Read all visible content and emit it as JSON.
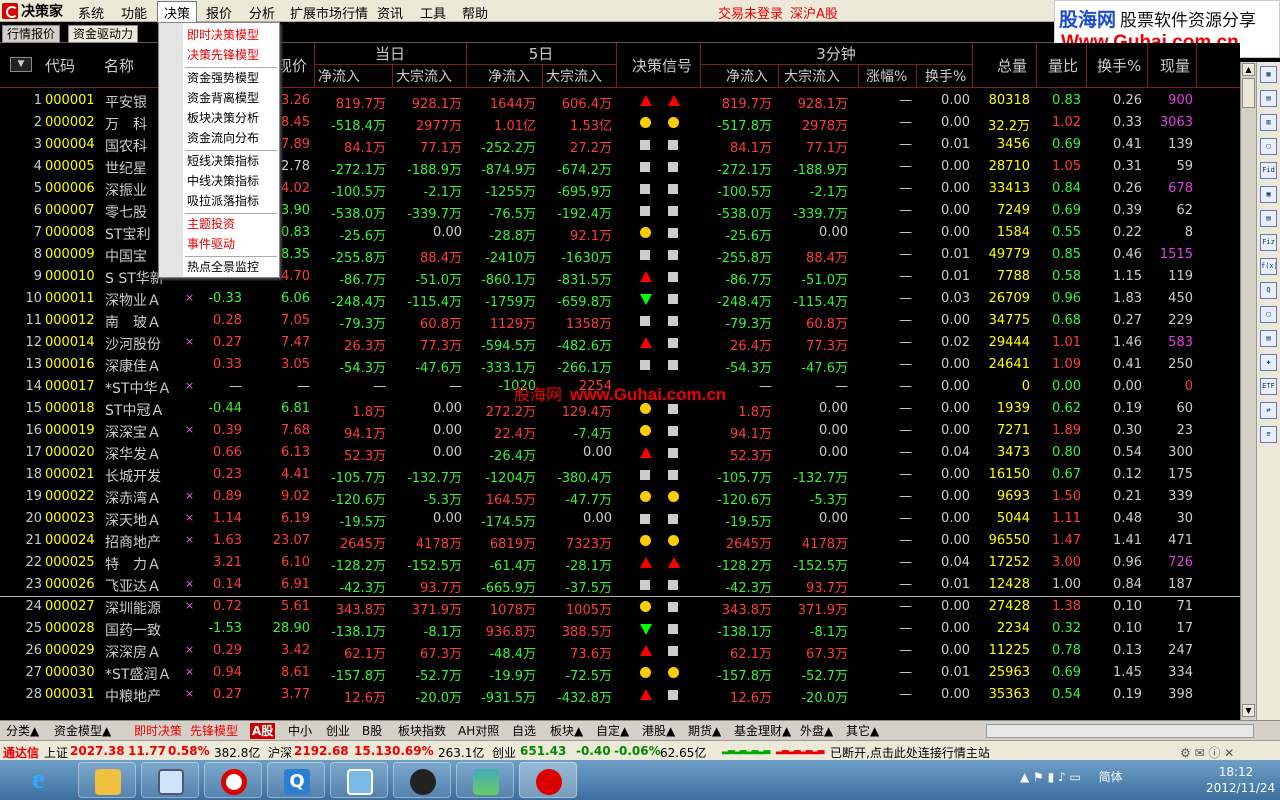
{
  "app": {
    "title": "决策家"
  },
  "menu": [
    "系统",
    "功能",
    "决策",
    "报价",
    "分析",
    "扩展市场行情",
    "资讯",
    "工具",
    "帮助"
  ],
  "menu_active": "决策",
  "trade_status": "交易未登录",
  "market_name": "深沪A股",
  "ad": {
    "site": "股海网",
    "tagline": "股票软件资源分享",
    "url": "Www.Guhai.com.cn"
  },
  "top_tabs": [
    "行情报价",
    "资金驱动力"
  ],
  "dropdown": [
    "即时决策模型",
    "决策先锋模型",
    "资金强势模型",
    "资金背离模型",
    "板块决策分析",
    "资金流向分布",
    "短线决策指标",
    "中线决策指标",
    "吸拉派落指标",
    "主题投资",
    "事件驱动",
    "热点全景监控"
  ],
  "dropdown_hot": [
    true,
    true,
    false,
    false,
    false,
    false,
    false,
    false,
    false,
    true,
    true,
    false
  ],
  "header": {
    "code": "代码",
    "name": "名称",
    "price": "现价",
    "today": "当日",
    "five_day": "5日",
    "signal": "决策信号",
    "three_min": "3分钟",
    "net_in": "净流入",
    "block_in": "大宗流入",
    "change_pct": "涨幅%",
    "turnover_pct": "换手%",
    "total_vol": "总量",
    "vol_ratio": "量比",
    "turnover": "换手%",
    "cur_vol": "现量"
  },
  "rows": [
    {
      "i": "1",
      "code": "000001",
      "name": "平安银",
      "x": "",
      "chg": "",
      "price": "3.26",
      "pc": "red",
      "tn": "819.7万",
      "tnc": "red",
      "tb": "928.1万",
      "tbc": "red",
      "fn": "1644万",
      "fnc": "red",
      "fb": "606.4万",
      "fbc": "red",
      "s1": "up",
      "s2": "up",
      "mn": "819.7万",
      "mnc": "red",
      "mb": "928.1万",
      "mbc": "red",
      "mp": "—",
      "mt": "0.00",
      "vol": "80318",
      "vr": "0.83",
      "vrc": "grn",
      "to": "0.26",
      "cv": "900",
      "cvc": "mag"
    },
    {
      "i": "2",
      "code": "000002",
      "name": "万　科",
      "x": "",
      "chg": "",
      "price": "8.45",
      "pc": "red",
      "tn": "-518.4万",
      "tnc": "grn",
      "tb": "2977万",
      "tbc": "red",
      "fn": "1.01亿",
      "fnc": "red",
      "fb": "1.53亿",
      "fbc": "red",
      "s1": "dot",
      "s2": "dot",
      "mn": "-517.8万",
      "mnc": "grn",
      "mb": "2978万",
      "mbc": "red",
      "mp": "—",
      "mt": "0.00",
      "vol": "32.2万",
      "vr": "1.02",
      "vrc": "red",
      "to": "0.33",
      "cv": "3063",
      "cvc": "mag"
    },
    {
      "i": "3",
      "code": "000004",
      "name": "国农科",
      "x": "",
      "chg": "",
      "price": "7.89",
      "pc": "red",
      "tn": "84.1万",
      "tnc": "red",
      "tb": "77.1万",
      "tbc": "red",
      "fn": "-252.2万",
      "fnc": "grn",
      "fb": "27.2万",
      "fbc": "red",
      "s1": "sq",
      "s2": "sq",
      "mn": "84.1万",
      "mnc": "red",
      "mb": "77.1万",
      "mbc": "red",
      "mp": "—",
      "mt": "0.01",
      "vol": "3456",
      "vr": "0.69",
      "vrc": "grn",
      "to": "0.41",
      "cv": "139",
      "cvc": "wht"
    },
    {
      "i": "4",
      "code": "000005",
      "name": "世纪星",
      "x": "",
      "chg": "",
      "price": "2.78",
      "pc": "wht",
      "tn": "-272.1万",
      "tnc": "grn",
      "tb": "-188.9万",
      "tbc": "grn",
      "fn": "-874.9万",
      "fnc": "grn",
      "fb": "-674.2万",
      "fbc": "grn",
      "s1": "sq",
      "s2": "sq",
      "mn": "-272.1万",
      "mnc": "grn",
      "mb": "-188.9万",
      "mbc": "grn",
      "mp": "—",
      "mt": "0.00",
      "vol": "28710",
      "vr": "1.05",
      "vrc": "red",
      "to": "0.31",
      "cv": "59",
      "cvc": "wht"
    },
    {
      "i": "5",
      "code": "000006",
      "name": "深振业",
      "x": "",
      "chg": "",
      "price": "4.02",
      "pc": "red",
      "tn": "-100.5万",
      "tnc": "grn",
      "tb": "-2.1万",
      "tbc": "grn",
      "fn": "-1255万",
      "fnc": "grn",
      "fb": "-695.9万",
      "fbc": "grn",
      "s1": "sq",
      "s2": "sq",
      "mn": "-100.5万",
      "mnc": "grn",
      "mb": "-2.1万",
      "mbc": "grn",
      "mp": "—",
      "mt": "0.00",
      "vol": "33413",
      "vr": "0.84",
      "vrc": "grn",
      "to": "0.26",
      "cv": "678",
      "cvc": "mag"
    },
    {
      "i": "6",
      "code": "000007",
      "name": "零七股",
      "x": "",
      "chg": "",
      "price": "3.90",
      "pc": "grn",
      "tn": "-538.0万",
      "tnc": "grn",
      "tb": "-339.7万",
      "tbc": "grn",
      "fn": "-76.5万",
      "fnc": "grn",
      "fb": "-192.4万",
      "fbc": "grn",
      "s1": "sq",
      "s2": "sq",
      "mn": "-538.0万",
      "mnc": "grn",
      "mb": "-339.7万",
      "mbc": "grn",
      "mp": "—",
      "mt": "0.00",
      "vol": "7249",
      "vr": "0.69",
      "vrc": "grn",
      "to": "0.39",
      "cv": "62",
      "cvc": "wht"
    },
    {
      "i": "7",
      "code": "000008",
      "name": "ST宝利",
      "x": "",
      "chg": "",
      "price": "0.83",
      "pc": "grn",
      "tn": "-25.6万",
      "tnc": "grn",
      "tb": "0.00",
      "tbc": "wht",
      "fn": "-28.8万",
      "fnc": "grn",
      "fb": "92.1万",
      "fbc": "red",
      "s1": "dot",
      "s2": "sq",
      "mn": "-25.6万",
      "mnc": "grn",
      "mb": "0.00",
      "mbc": "wht",
      "mp": "—",
      "mt": "0.00",
      "vol": "1584",
      "vr": "0.55",
      "vrc": "grn",
      "to": "0.22",
      "cv": "8",
      "cvc": "wht"
    },
    {
      "i": "8",
      "code": "000009",
      "name": "中国宝",
      "x": "",
      "chg": "",
      "price": "8.35",
      "pc": "grn",
      "tn": "-255.8万",
      "tnc": "grn",
      "tb": "88.4万",
      "tbc": "red",
      "fn": "-2410万",
      "fnc": "grn",
      "fb": "-1630万",
      "fbc": "grn",
      "s1": "sq",
      "s2": "sq",
      "mn": "-255.8万",
      "mnc": "grn",
      "mb": "88.4万",
      "mbc": "red",
      "mp": "—",
      "mt": "0.01",
      "vol": "49779",
      "vr": "0.85",
      "vrc": "grn",
      "to": "0.46",
      "cv": "1515",
      "cvc": "mag"
    },
    {
      "i": "9",
      "code": "000010",
      "name": "S ST华新",
      "x": "",
      "chg": "",
      "price": "4.70",
      "pc": "red",
      "tn": "-86.7万",
      "tnc": "grn",
      "tb": "-51.0万",
      "tbc": "grn",
      "fn": "-860.1万",
      "fnc": "grn",
      "fb": "-831.5万",
      "fbc": "grn",
      "s1": "up",
      "s2": "sq",
      "mn": "-86.7万",
      "mnc": "grn",
      "mb": "-51.0万",
      "mbc": "grn",
      "mp": "—",
      "mt": "0.01",
      "vol": "7788",
      "vr": "0.58",
      "vrc": "grn",
      "to": "1.15",
      "cv": "119",
      "cvc": "wht"
    },
    {
      "i": "10",
      "code": "000011",
      "name": "深物业Ａ",
      "x": "×",
      "chg": "-0.33",
      "chgc": "grn",
      "price": "6.06",
      "pc": "grn",
      "tn": "-248.4万",
      "tnc": "grn",
      "tb": "-115.4万",
      "tbc": "grn",
      "fn": "-1759万",
      "fnc": "grn",
      "fb": "-659.8万",
      "fbc": "grn",
      "s1": "down",
      "s2": "sq",
      "mn": "-248.4万",
      "mnc": "grn",
      "mb": "-115.4万",
      "mbc": "grn",
      "mp": "—",
      "mt": "0.03",
      "vol": "26709",
      "vr": "0.96",
      "vrc": "grn",
      "to": "1.83",
      "cv": "450",
      "cvc": "wht"
    },
    {
      "i": "11",
      "code": "000012",
      "name": "南　玻Ａ",
      "x": "",
      "chg": "0.28",
      "chgc": "red",
      "price": "7.05",
      "pc": "red",
      "tn": "-79.3万",
      "tnc": "grn",
      "tb": "60.8万",
      "tbc": "red",
      "fn": "1129万",
      "fnc": "red",
      "fb": "1358万",
      "fbc": "red",
      "s1": "sq",
      "s2": "sq",
      "mn": "-79.3万",
      "mnc": "grn",
      "mb": "60.8万",
      "mbc": "red",
      "mp": "—",
      "mt": "0.00",
      "vol": "34775",
      "vr": "0.68",
      "vrc": "grn",
      "to": "0.27",
      "cv": "229",
      "cvc": "wht"
    },
    {
      "i": "12",
      "code": "000014",
      "name": "沙河股份",
      "x": "×",
      "chg": "0.27",
      "chgc": "red",
      "price": "7.47",
      "pc": "red",
      "tn": "26.3万",
      "tnc": "red",
      "tb": "77.3万",
      "tbc": "red",
      "fn": "-594.5万",
      "fnc": "grn",
      "fb": "-482.6万",
      "fbc": "grn",
      "s1": "up",
      "s2": "sq",
      "mn": "26.4万",
      "mnc": "red",
      "mb": "77.3万",
      "mbc": "red",
      "mp": "—",
      "mt": "0.02",
      "vol": "29444",
      "vr": "1.01",
      "vrc": "red",
      "to": "1.46",
      "cv": "583",
      "cvc": "mag"
    },
    {
      "i": "13",
      "code": "000016",
      "name": "深康佳Ａ",
      "x": "",
      "chg": "0.33",
      "chgc": "red",
      "price": "3.05",
      "pc": "red",
      "tn": "-54.3万",
      "tnc": "grn",
      "tb": "-47.6万",
      "tbc": "grn",
      "fn": "-333.1万",
      "fnc": "grn",
      "fb": "-266.1万",
      "fbc": "grn",
      "s1": "sq",
      "s2": "sq",
      "mn": "-54.3万",
      "mnc": "grn",
      "mb": "-47.6万",
      "mbc": "grn",
      "mp": "—",
      "mt": "0.00",
      "vol": "24641",
      "vr": "1.09",
      "vrc": "red",
      "to": "0.41",
      "cv": "250",
      "cvc": "wht"
    },
    {
      "i": "14",
      "code": "000017",
      "name": "*ST中华Ａ",
      "x": "×",
      "chg": "—",
      "chgc": "wht",
      "price": "—",
      "pc": "wht",
      "tn": "—",
      "tnc": "wht",
      "tb": "—",
      "tbc": "wht",
      "fn": "-1020",
      "fnc": "grn",
      "fb": "2254",
      "fbc": "red",
      "s1": "",
      "s2": "",
      "mn": "—",
      "mnc": "wht",
      "mb": "—",
      "mbc": "wht",
      "mp": "—",
      "mt": "0.00",
      "vol": "0",
      "vr": "0.00",
      "vrc": "grn",
      "to": "0.00",
      "cv": "0",
      "cvc": "red"
    },
    {
      "i": "15",
      "code": "000018",
      "name": "ST中冠Ａ",
      "x": "",
      "chg": "-0.44",
      "chgc": "grn",
      "price": "6.81",
      "pc": "grn",
      "tn": "1.8万",
      "tnc": "red",
      "tb": "0.00",
      "tbc": "wht",
      "fn": "272.2万",
      "fnc": "red",
      "fb": "129.4万",
      "fbc": "red",
      "s1": "dot",
      "s2": "sq",
      "mn": "1.8万",
      "mnc": "red",
      "mb": "0.00",
      "mbc": "wht",
      "mp": "—",
      "mt": "0.00",
      "vol": "1939",
      "vr": "0.62",
      "vrc": "grn",
      "to": "0.19",
      "cv": "60",
      "cvc": "wht"
    },
    {
      "i": "16",
      "code": "000019",
      "name": "深深宝Ａ",
      "x": "×",
      "chg": "0.39",
      "chgc": "red",
      "price": "7.68",
      "pc": "red",
      "tn": "94.1万",
      "tnc": "red",
      "tb": "0.00",
      "tbc": "wht",
      "fn": "22.4万",
      "fnc": "red",
      "fb": "-7.4万",
      "fbc": "grn",
      "s1": "dot",
      "s2": "sq",
      "mn": "94.1万",
      "mnc": "red",
      "mb": "0.00",
      "mbc": "wht",
      "mp": "—",
      "mt": "0.00",
      "vol": "7271",
      "vr": "1.89",
      "vrc": "red",
      "to": "0.30",
      "cv": "23",
      "cvc": "wht"
    },
    {
      "i": "17",
      "code": "000020",
      "name": "深华发Ａ",
      "x": "",
      "chg": "0.66",
      "chgc": "red",
      "price": "6.13",
      "pc": "red",
      "tn": "52.3万",
      "tnc": "red",
      "tb": "0.00",
      "tbc": "wht",
      "fn": "-26.4万",
      "fnc": "grn",
      "fb": "0.00",
      "fbc": "wht",
      "s1": "up",
      "s2": "sq",
      "mn": "52.3万",
      "mnc": "red",
      "mb": "0.00",
      "mbc": "wht",
      "mp": "—",
      "mt": "0.04",
      "vol": "3473",
      "vr": "0.80",
      "vrc": "grn",
      "to": "0.54",
      "cv": "300",
      "cvc": "wht"
    },
    {
      "i": "18",
      "code": "000021",
      "name": "长城开发",
      "x": "",
      "chg": "0.23",
      "chgc": "red",
      "price": "4.41",
      "pc": "red",
      "tn": "-105.7万",
      "tnc": "grn",
      "tb": "-132.7万",
      "tbc": "grn",
      "fn": "-1204万",
      "fnc": "grn",
      "fb": "-380.4万",
      "fbc": "grn",
      "s1": "sq",
      "s2": "sq",
      "mn": "-105.7万",
      "mnc": "grn",
      "mb": "-132.7万",
      "mbc": "grn",
      "mp": "—",
      "mt": "0.00",
      "vol": "16150",
      "vr": "0.67",
      "vrc": "grn",
      "to": "0.12",
      "cv": "175",
      "cvc": "wht"
    },
    {
      "i": "19",
      "code": "000022",
      "name": "深赤湾Ａ",
      "x": "×",
      "chg": "0.89",
      "chgc": "red",
      "price": "9.02",
      "pc": "red",
      "tn": "-120.6万",
      "tnc": "grn",
      "tb": "-5.3万",
      "tbc": "grn",
      "fn": "164.5万",
      "fnc": "red",
      "fb": "-47.7万",
      "fbc": "grn",
      "s1": "dot",
      "s2": "dot",
      "mn": "-120.6万",
      "mnc": "grn",
      "mb": "-5.3万",
      "mbc": "grn",
      "mp": "—",
      "mt": "0.00",
      "vol": "9693",
      "vr": "1.50",
      "vrc": "red",
      "to": "0.21",
      "cv": "339",
      "cvc": "wht"
    },
    {
      "i": "20",
      "code": "000023",
      "name": "深天地Ａ",
      "x": "×",
      "chg": "1.14",
      "chgc": "red",
      "price": "6.19",
      "pc": "red",
      "tn": "-19.5万",
      "tnc": "grn",
      "tb": "0.00",
      "tbc": "wht",
      "fn": "-174.5万",
      "fnc": "grn",
      "fb": "0.00",
      "fbc": "wht",
      "s1": "sq",
      "s2": "sq",
      "mn": "-19.5万",
      "mnc": "grn",
      "mb": "0.00",
      "mbc": "wht",
      "mp": "—",
      "mt": "0.00",
      "vol": "5044",
      "vr": "1.11",
      "vrc": "red",
      "to": "0.48",
      "cv": "30",
      "cvc": "wht"
    },
    {
      "i": "21",
      "code": "000024",
      "name": "招商地产",
      "x": "×",
      "chg": "1.63",
      "chgc": "red",
      "price": "23.07",
      "pc": "red",
      "tn": "2645万",
      "tnc": "red",
      "tb": "4178万",
      "tbc": "red",
      "fn": "6819万",
      "fnc": "red",
      "fb": "7323万",
      "fbc": "red",
      "s1": "dot",
      "s2": "dot",
      "mn": "2645万",
      "mnc": "red",
      "mb": "4178万",
      "mbc": "red",
      "mp": "—",
      "mt": "0.00",
      "vol": "96550",
      "vr": "1.47",
      "vrc": "red",
      "to": "1.41",
      "cv": "471",
      "cvc": "wht"
    },
    {
      "i": "22",
      "code": "000025",
      "name": "特　力Ａ",
      "x": "",
      "chg": "3.21",
      "chgc": "red",
      "price": "6.10",
      "pc": "red",
      "tn": "-128.2万",
      "tnc": "grn",
      "tb": "-152.5万",
      "tbc": "grn",
      "fn": "-61.4万",
      "fnc": "grn",
      "fb": "-28.1万",
      "fbc": "grn",
      "s1": "up",
      "s2": "up",
      "mn": "-128.2万",
      "mnc": "grn",
      "mb": "-152.5万",
      "mbc": "grn",
      "mp": "—",
      "mt": "0.04",
      "vol": "17252",
      "vr": "3.00",
      "vrc": "red",
      "to": "0.96",
      "cv": "726",
      "cvc": "mag"
    },
    {
      "i": "23",
      "code": "000026",
      "name": "飞亚达Ａ",
      "x": "×",
      "chg": "0.14",
      "chgc": "red",
      "price": "6.91",
      "pc": "red",
      "tn": "-42.3万",
      "tnc": "grn",
      "tb": "93.7万",
      "tbc": "red",
      "fn": "-665.9万",
      "fnc": "grn",
      "fb": "-37.5万",
      "fbc": "grn",
      "s1": "sq",
      "s2": "sq",
      "mn": "-42.3万",
      "mnc": "grn",
      "mb": "93.7万",
      "mbc": "red",
      "mp": "—",
      "mt": "0.01",
      "vol": "12428",
      "vr": "1.00",
      "vrc": "wht",
      "to": "0.84",
      "cv": "187",
      "cvc": "wht"
    },
    {
      "i": "24",
      "code": "000027",
      "name": "深圳能源",
      "x": "×",
      "chg": "0.72",
      "chgc": "red",
      "price": "5.61",
      "pc": "red",
      "tn": "343.8万",
      "tnc": "red",
      "tb": "371.9万",
      "tbc": "red",
      "fn": "1078万",
      "fnc": "red",
      "fb": "1005万",
      "fbc": "red",
      "s1": "dot",
      "s2": "sq",
      "mn": "343.8万",
      "mnc": "red",
      "mb": "371.9万",
      "mbc": "red",
      "mp": "—",
      "mt": "0.00",
      "vol": "27428",
      "vr": "1.38",
      "vrc": "red",
      "to": "0.10",
      "cv": "71",
      "cvc": "wht"
    },
    {
      "i": "25",
      "code": "000028",
      "name": "国药一致",
      "x": "",
      "chg": "-1.53",
      "chgc": "grn",
      "price": "28.90",
      "pc": "grn",
      "tn": "-138.1万",
      "tnc": "grn",
      "tb": "-8.1万",
      "tbc": "grn",
      "fn": "936.8万",
      "fnc": "red",
      "fb": "388.5万",
      "fbc": "red",
      "s1": "down",
      "s2": "sq",
      "mn": "-138.1万",
      "mnc": "grn",
      "mb": "-8.1万",
      "mbc": "grn",
      "mp": "—",
      "mt": "0.00",
      "vol": "2234",
      "vr": "0.32",
      "vrc": "grn",
      "to": "0.10",
      "cv": "17",
      "cvc": "wht"
    },
    {
      "i": "26",
      "code": "000029",
      "name": "深深房Ａ",
      "x": "×",
      "chg": "0.29",
      "chgc": "red",
      "price": "3.42",
      "pc": "red",
      "tn": "62.1万",
      "tnc": "red",
      "tb": "67.3万",
      "tbc": "red",
      "fn": "-48.4万",
      "fnc": "grn",
      "fb": "73.6万",
      "fbc": "red",
      "s1": "up",
      "s2": "sq",
      "mn": "62.1万",
      "mnc": "red",
      "mb": "67.3万",
      "mbc": "red",
      "mp": "—",
      "mt": "0.00",
      "vol": "11225",
      "vr": "0.78",
      "vrc": "grn",
      "to": "0.13",
      "cv": "247",
      "cvc": "wht"
    },
    {
      "i": "27",
      "code": "000030",
      "name": "*ST盛润Ａ",
      "x": "×",
      "chg": "0.94",
      "chgc": "red",
      "price": "8.61",
      "pc": "red",
      "tn": "-157.8万",
      "tnc": "grn",
      "tb": "-52.7万",
      "tbc": "grn",
      "fn": "-19.9万",
      "fnc": "grn",
      "fb": "-72.5万",
      "fbc": "grn",
      "s1": "dot",
      "s2": "dot",
      "mn": "-157.8万",
      "mnc": "grn",
      "mb": "-52.7万",
      "mbc": "grn",
      "mp": "—",
      "mt": "0.01",
      "vol": "25963",
      "vr": "0.69",
      "vrc": "grn",
      "to": "1.45",
      "cv": "334",
      "cvc": "wht"
    },
    {
      "i": "28",
      "code": "000031",
      "name": "中粮地产",
      "x": "×",
      "chg": "0.27",
      "chgc": "red",
      "price": "3.77",
      "pc": "red",
      "tn": "12.6万",
      "tnc": "red",
      "tb": "-20.0万",
      "tbc": "grn",
      "fn": "-931.5万",
      "fnc": "grn",
      "fb": "-432.8万",
      "fbc": "grn",
      "s1": "up",
      "s2": "sq",
      "mn": "12.6万",
      "mnc": "red",
      "mb": "-20.0万",
      "mbc": "grn",
      "mp": "—",
      "mt": "0.00",
      "vol": "35363",
      "vr": "0.54",
      "vrc": "grn",
      "to": "0.19",
      "cv": "398",
      "cvc": "wht"
    }
  ],
  "bottom_tabs": [
    {
      "label": "分类▲",
      "kind": ""
    },
    {
      "label": "资金模型▲",
      "kind": ""
    },
    {
      "label": "即时决策",
      "kind": "hot"
    },
    {
      "label": "先锋模型",
      "kind": "hot"
    },
    {
      "label": "A股",
      "kind": "sel"
    },
    {
      "label": "中小",
      "kind": ""
    },
    {
      "label": "创业",
      "kind": ""
    },
    {
      "label": "B股",
      "kind": ""
    },
    {
      "label": "板块指数",
      "kind": ""
    },
    {
      "label": "AH对照",
      "kind": ""
    },
    {
      "label": "自选",
      "kind": ""
    },
    {
      "label": "板块▲",
      "kind": ""
    },
    {
      "label": "自定▲",
      "kind": ""
    },
    {
      "label": "港股▲",
      "kind": ""
    },
    {
      "label": "期货▲",
      "kind": ""
    },
    {
      "label": "基金理财▲",
      "kind": ""
    },
    {
      "label": "外盘▲",
      "kind": ""
    },
    {
      "label": "其它▲",
      "kind": ""
    }
  ],
  "status": {
    "brand": "通达信",
    "sh_label": "上证",
    "sh_val": "2027.38",
    "sh_chg": "11.77",
    "sh_pct": "0.58%",
    "sh_amt": "382.8亿",
    "sz_label": "沪深",
    "sz_val": "2192.68",
    "sz_chg": "15.13",
    "sz_pct": "0.69%",
    "sz_amt": "263.1亿",
    "cy_label": "创业",
    "cy_val": "651.43",
    "cy_chg": "-0.40",
    "cy_pct": "-0.06%",
    "cy_amt": "62.65亿",
    "conn": "已断开,点击此处连接行情主站"
  },
  "tray": {
    "lang": "简体",
    "time": "18:12",
    "date": "2012/11/24"
  },
  "watermark": {
    "cn": "股海网",
    "url": "www.Guhai.com.cn"
  },
  "rtool": [
    "▦",
    "▤",
    "▥",
    "▢",
    "Fid",
    "▣",
    "▤",
    "Fiz",
    "f(x)",
    "Q",
    "▢",
    "▤",
    "✚",
    "ETF",
    "⇄",
    "≡"
  ],
  "colors": {
    "up": "#ff3c3c",
    "down": "#3cf03c",
    "code": "#ffff00",
    "grid_line": "#7a2020"
  }
}
